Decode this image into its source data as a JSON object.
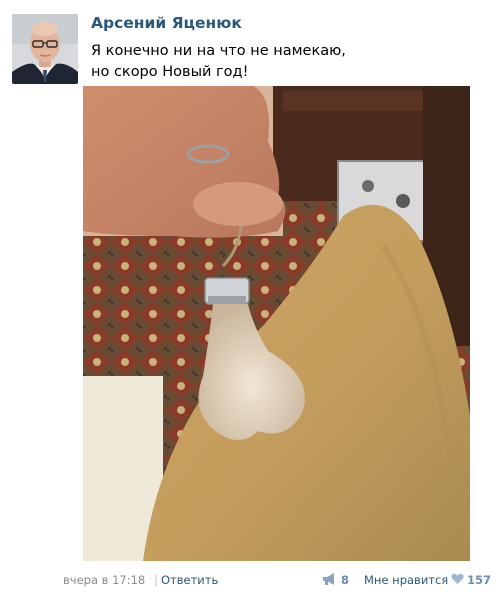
{
  "post": {
    "author": "Арсений Яценюк",
    "text_lines": [
      "Я конечно ни на что не намекаю,",
      "но скоро Новый год!"
    ],
    "time": "вчера в 17:18",
    "separator": "|",
    "reply_label": "Ответить",
    "share_count": "8",
    "like_label": "Мне нравится",
    "like_count": "157"
  },
  "colors": {
    "link": "#2b587a",
    "meta": "#8a8a8a",
    "counter": "#6b8db0"
  },
  "icons": {
    "share": "megaphone-icon",
    "like": "heart-icon"
  }
}
